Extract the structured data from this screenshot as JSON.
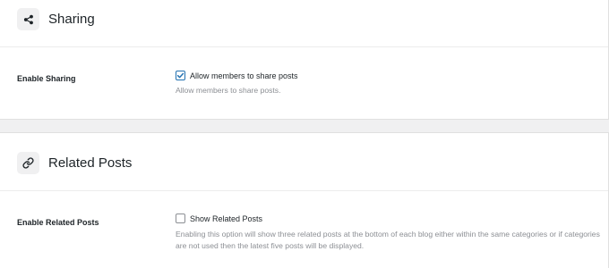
{
  "sharing": {
    "title": "Sharing",
    "icon": "share-icon",
    "field_label": "Enable Sharing",
    "checkbox_label": "Allow members to share posts",
    "checked": true,
    "help_text": "Allow members to share posts."
  },
  "related": {
    "title": "Related Posts",
    "icon": "link-icon",
    "field_label": "Enable Related Posts",
    "checkbox_label": "Show Related Posts",
    "checked": false,
    "help_text": "Enabling this option will show three related posts at the bottom of each blog either within the same categories or if categories are not used then the latest five posts will be displayed."
  },
  "colors": {
    "accent": "#2271b1",
    "page_bg": "#f0f0f1",
    "help_text": "#8c8f94"
  }
}
